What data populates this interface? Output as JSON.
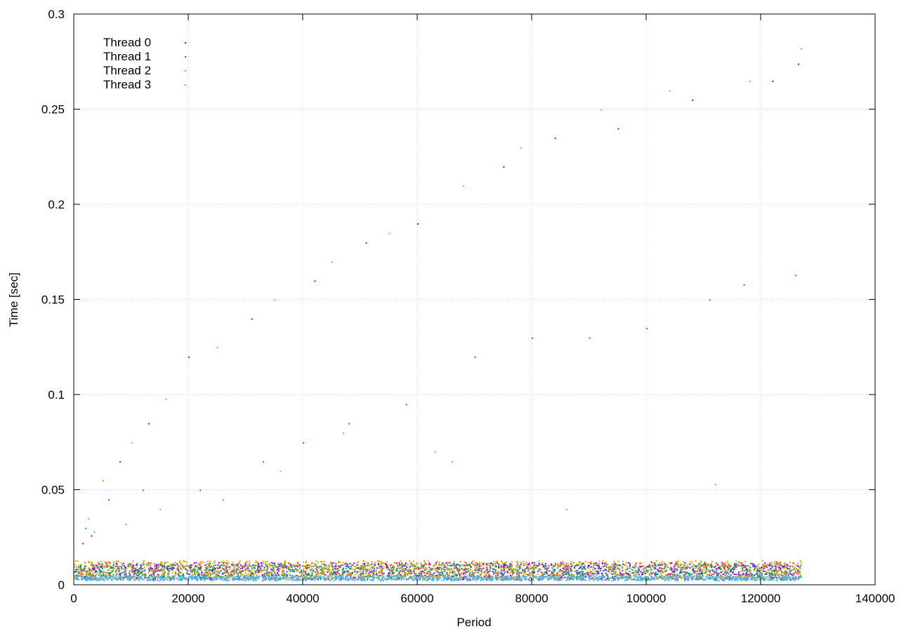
{
  "chart_data": {
    "type": "scatter",
    "title": "",
    "xlabel": "Period",
    "ylabel": "Time [sec]",
    "xlim": [
      0,
      140000
    ],
    "ylim": [
      0,
      0.3
    ],
    "xticks": [
      0,
      20000,
      40000,
      60000,
      80000,
      100000,
      120000,
      140000
    ],
    "yticks": [
      0,
      0.05,
      0.1,
      0.15,
      0.2,
      0.25,
      0.3
    ],
    "xtick_labels": [
      "0",
      "20000",
      "40000",
      "60000",
      "80000",
      "100000",
      "120000",
      "140000"
    ],
    "ytick_labels": [
      "0",
      "0.05",
      "0.1",
      "0.15",
      "0.2",
      "0.25",
      "0.3"
    ],
    "grid": true,
    "legend_position": "top-left",
    "series": [
      {
        "name": "Thread 0",
        "color": "#9400d3",
        "band": {
          "x_range": [
            0,
            127000
          ],
          "y_range": [
            0.003,
            0.012
          ]
        },
        "outliers": [
          [
            1500,
            0.022
          ],
          [
            3000,
            0.026
          ],
          [
            8000,
            0.065
          ],
          [
            13000,
            0.085
          ],
          [
            20000,
            0.12
          ],
          [
            31000,
            0.14
          ],
          [
            42000,
            0.16
          ],
          [
            51000,
            0.18
          ],
          [
            60000,
            0.19
          ],
          [
            75000,
            0.22
          ],
          [
            84000,
            0.235
          ],
          [
            95000,
            0.24
          ],
          [
            108000,
            0.255
          ],
          [
            122000,
            0.265
          ],
          [
            126500,
            0.274
          ]
        ]
      },
      {
        "name": "Thread 1",
        "color": "#009e73",
        "band": {
          "x_range": [
            0,
            127000
          ],
          "y_range": [
            0.003,
            0.011
          ]
        },
        "outliers": [
          [
            2000,
            0.03
          ],
          [
            6000,
            0.045
          ],
          [
            12000,
            0.05
          ],
          [
            22000,
            0.05
          ],
          [
            33000,
            0.065
          ],
          [
            40000,
            0.075
          ],
          [
            48000,
            0.085
          ],
          [
            58000,
            0.095
          ],
          [
            70000,
            0.12
          ],
          [
            80000,
            0.13
          ],
          [
            90000,
            0.13
          ],
          [
            100000,
            0.135
          ],
          [
            111000,
            0.15
          ],
          [
            117000,
            0.158
          ],
          [
            126000,
            0.163
          ]
        ]
      },
      {
        "name": "Thread 2",
        "color": "#56b4e9",
        "band": {
          "x_range": [
            0,
            127000
          ],
          "y_range": [
            0.0025,
            0.005
          ]
        },
        "outliers": [
          [
            3500,
            0.028
          ],
          [
            9000,
            0.032
          ],
          [
            15000,
            0.04
          ],
          [
            26000,
            0.045
          ],
          [
            36000,
            0.06
          ],
          [
            47000,
            0.08
          ],
          [
            63000,
            0.07
          ],
          [
            66000,
            0.065
          ],
          [
            86000,
            0.04
          ],
          [
            112000,
            0.053
          ]
        ]
      },
      {
        "name": "Thread 3",
        "color": "#e69f00",
        "band": {
          "x_range": [
            0,
            127000
          ],
          "y_range": [
            0.004,
            0.013
          ]
        },
        "outliers": [
          [
            2500,
            0.035
          ],
          [
            5000,
            0.055
          ],
          [
            10000,
            0.075
          ],
          [
            16000,
            0.098
          ],
          [
            25000,
            0.125
          ],
          [
            35000,
            0.15
          ],
          [
            45000,
            0.17
          ],
          [
            55000,
            0.185
          ],
          [
            68000,
            0.21
          ],
          [
            78000,
            0.23
          ],
          [
            92000,
            0.25
          ],
          [
            104000,
            0.26
          ],
          [
            118000,
            0.265
          ],
          [
            127000,
            0.282
          ]
        ]
      }
    ]
  }
}
